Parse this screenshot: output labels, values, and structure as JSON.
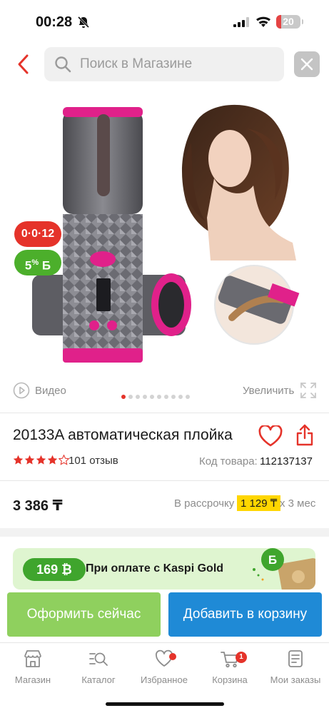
{
  "status_bar": {
    "time": "00:28",
    "battery": "20"
  },
  "search": {
    "placeholder": "Поиск в Магазине"
  },
  "badges": {
    "timer": "0·0·12",
    "bonus_percent": "5",
    "bonus_suffix": "%",
    "bonus_currency": "Б"
  },
  "gallery": {
    "video_label": "Видео",
    "zoom_label": "Увеличить",
    "image_count": 10,
    "active_index": 0
  },
  "product": {
    "title": "20133A автоматическая плойка",
    "rating": 4,
    "reviews": "101 отзыв",
    "sku_label": "Код товара:",
    "sku_value": "112137137",
    "price": "3 386 ₸",
    "installment_label": "В рассрочку",
    "installment_amount": "1 129 ₸",
    "installment_term": "x 3 мес"
  },
  "promo": {
    "bonus": "169 ₿",
    "text": "При оплате с Kaspi Gold"
  },
  "actions": {
    "checkout": "Оформить сейчас",
    "add_to_cart": "Добавить в корзину"
  },
  "tabbar": {
    "items": [
      {
        "label": "Магазин",
        "icon": "store-icon"
      },
      {
        "label": "Каталог",
        "icon": "catalog-search-icon"
      },
      {
        "label": "Избранное",
        "icon": "heart-icon"
      },
      {
        "label": "Корзина",
        "icon": "cart-icon",
        "badge": "1"
      },
      {
        "label": "Мои заказы",
        "icon": "orders-icon"
      }
    ]
  },
  "colors": {
    "brand_red": "#e5332a",
    "bonus_green": "#4caf2b",
    "checkout_green": "#8fd05e",
    "cart_blue": "#1f8ad6",
    "installment_yellow": "#ffd600"
  }
}
